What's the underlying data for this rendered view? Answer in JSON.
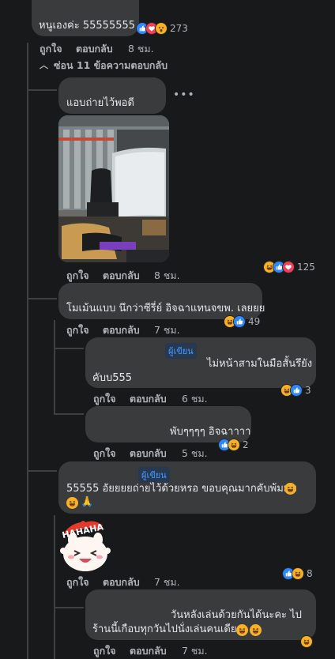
{
  "actions": {
    "like": "ถูกใจ",
    "reply": "ตอบกลับ"
  },
  "author_badge": "ผู้เขียน",
  "hide_replies": "ซ่อน 11 ข้อความตอบกลับ",
  "top_comment": {
    "text": "หนูเองค่ะ 55555555",
    "reaction_count": "273",
    "time": "8 ชม."
  },
  "reply1": {
    "text": "แอบถ่ายไว้พอดี",
    "photo_alt": "desk with gaming chair and monitors",
    "reaction_count": "125",
    "time": "8 ชม."
  },
  "reply2": {
    "text": "โมเม้นแบบ นึกว่าซีรี่ย์ อิจฉาแทนจขพ. เลยยย",
    "reaction_count": "49",
    "time": "7 ชม."
  },
  "reply2a": {
    "line1": "ไม่หน้าสามในมือสั้นรึยัง",
    "line2": "คับบ555",
    "reaction_count": "3",
    "time": "6 ชม."
  },
  "reply2b": {
    "text": "พับๆๆๆๆ อิจฉาาาา",
    "reaction_count": "2",
    "time": "5 ชม."
  },
  "reply3": {
    "line1": "55555 อัยยยยถ่ายไว้ด้วยหรอ ขอบคุณมากคับพ้มมม",
    "sticker_text": "HAHAHA",
    "reaction_count": "8",
    "time": "7 ชม."
  },
  "reply3a": {
    "line1": "วันหลังเล่นด้วยกันได้นะคะ ไป",
    "line2": "ร้านนี้เกือบทุกวันไปนั่งเล่นคนเดียว",
    "time": "7 ชม."
  },
  "colors": {
    "background": "#18191a",
    "bubble": "#3a3b3c",
    "text": "#e4e6eb",
    "meta": "#b0b3b8",
    "author": "#4599ff",
    "like": "#2d88ff",
    "love": "#f33e58",
    "haha": "#f7b125"
  }
}
